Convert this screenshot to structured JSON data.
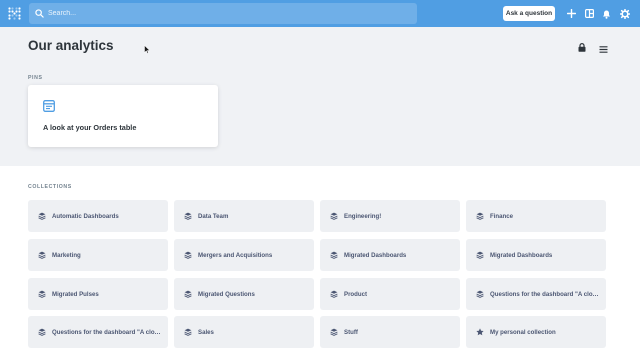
{
  "nav": {
    "search_placeholder": "Search...",
    "ask_label": "Ask a question",
    "brand_color": "#509ee3"
  },
  "page": {
    "title": "Our analytics"
  },
  "pins": {
    "label": "PINS",
    "items": [
      {
        "title": "A look at your Orders table",
        "icon": "table-icon"
      }
    ]
  },
  "collections": {
    "label": "COLLECTIONS",
    "items": [
      {
        "label": "Automatic Dashboards",
        "icon": "collection-icon"
      },
      {
        "label": "Data Team",
        "icon": "collection-icon"
      },
      {
        "label": "Engineering!",
        "icon": "collection-icon"
      },
      {
        "label": "Finance",
        "icon": "collection-icon"
      },
      {
        "label": "Marketing",
        "icon": "collection-icon"
      },
      {
        "label": "Mergers and Acquisitions",
        "icon": "collection-icon"
      },
      {
        "label": "Migrated Dashboards",
        "icon": "collection-icon"
      },
      {
        "label": "Migrated Dashboards",
        "icon": "collection-icon"
      },
      {
        "label": "Migrated Pulses",
        "icon": "collection-icon"
      },
      {
        "label": "Migrated Questions",
        "icon": "collection-icon"
      },
      {
        "label": "Product",
        "icon": "collection-icon"
      },
      {
        "label": "Questions for the dashboard \"A close...",
        "icon": "collection-icon"
      },
      {
        "label": "Questions for the dashboard \"A close...",
        "icon": "collection-icon"
      },
      {
        "label": "Sales",
        "icon": "collection-icon"
      },
      {
        "label": "Stuff",
        "icon": "collection-icon"
      },
      {
        "label": "My personal collection",
        "icon": "star-icon"
      }
    ]
  }
}
